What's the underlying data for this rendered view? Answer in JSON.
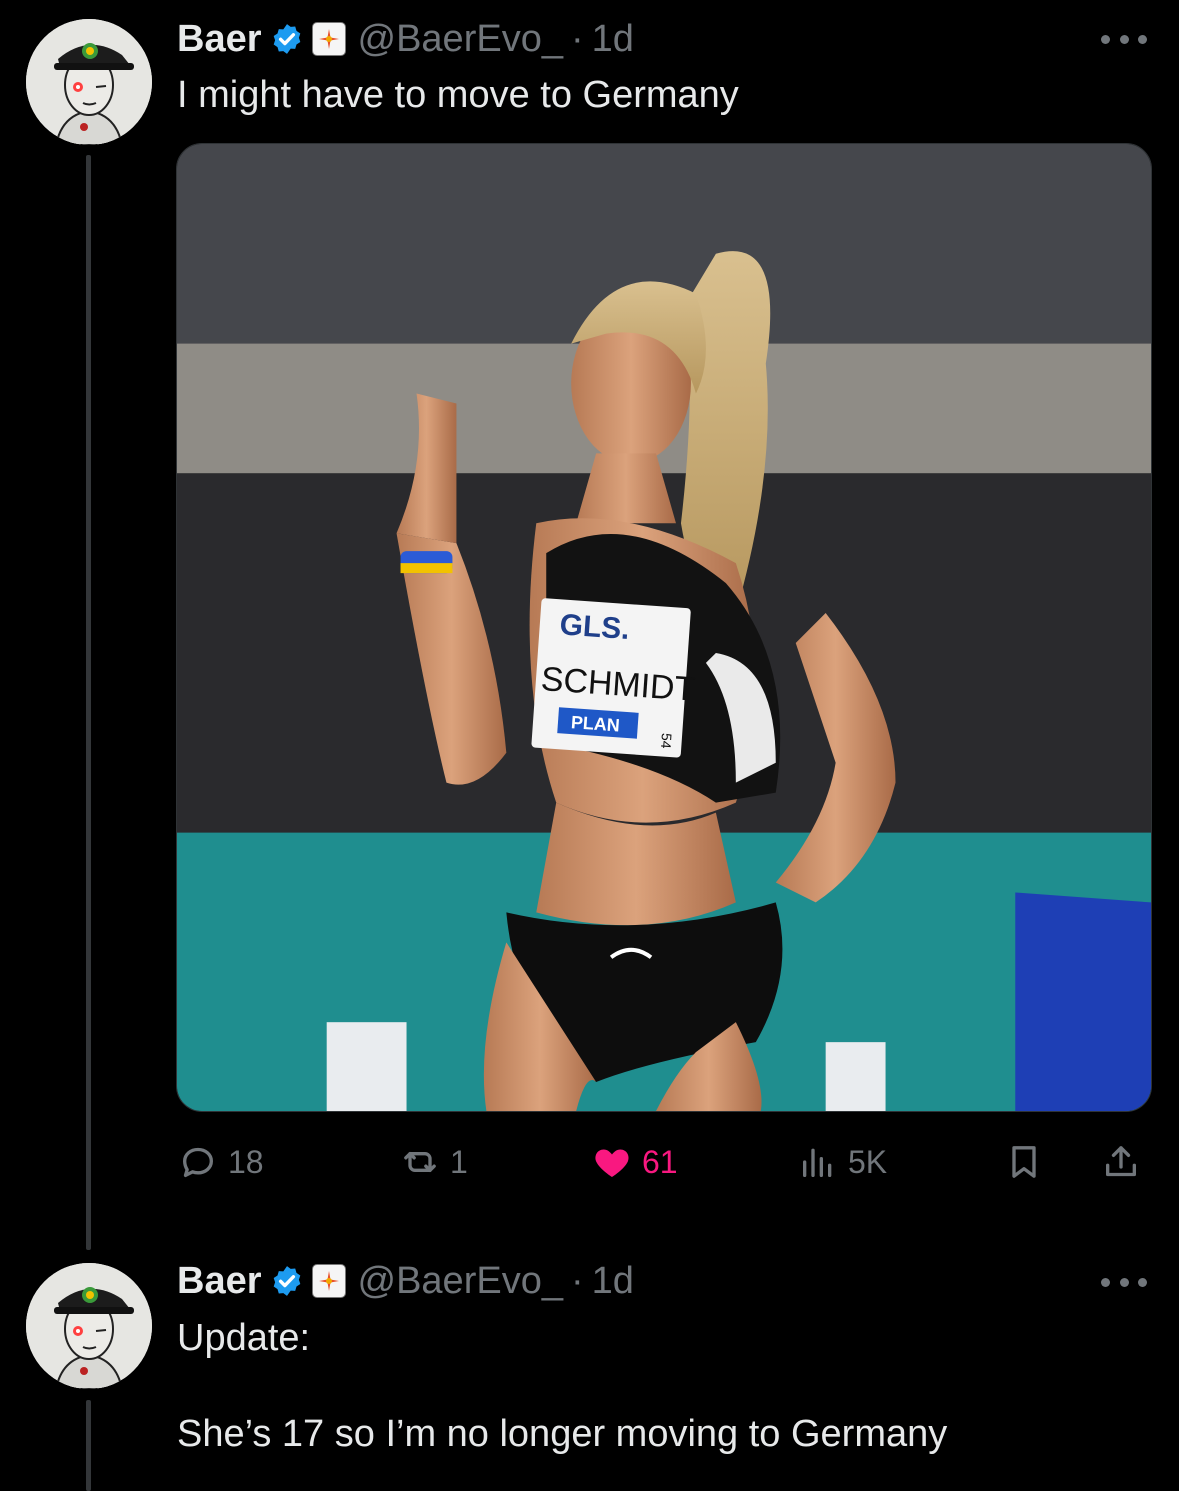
{
  "tweets": [
    {
      "author_name": "Baer",
      "handle": "@BaerEvo_",
      "separator": "·",
      "time": "1d",
      "text": "I might have to move to Germany",
      "stats": {
        "replies": "18",
        "reposts": "1",
        "likes": "61",
        "views": "5K"
      }
    },
    {
      "author_name": "Baer",
      "handle": "@BaerEvo_",
      "separator": "·",
      "time": "1d",
      "text": "Update:\n\nShe’s 17 so I’m no longer moving to Germany"
    }
  ],
  "media": {
    "bib_sponsor": "GLS.",
    "bib_name": "SCHMIDT",
    "bib_footer": "PLAN",
    "bib_number": "54"
  },
  "colors": {
    "background": "#000000",
    "text_primary": "#e7e9ea",
    "text_secondary": "#71767b",
    "verified": "#1d9bf0",
    "like": "#f91880",
    "thread_line": "#333639"
  },
  "icons": [
    "verified-badge-icon",
    "affiliate-badge-icon",
    "more-icon",
    "reply-icon",
    "repost-icon",
    "like-icon",
    "views-icon",
    "bookmark-icon",
    "share-icon"
  ]
}
